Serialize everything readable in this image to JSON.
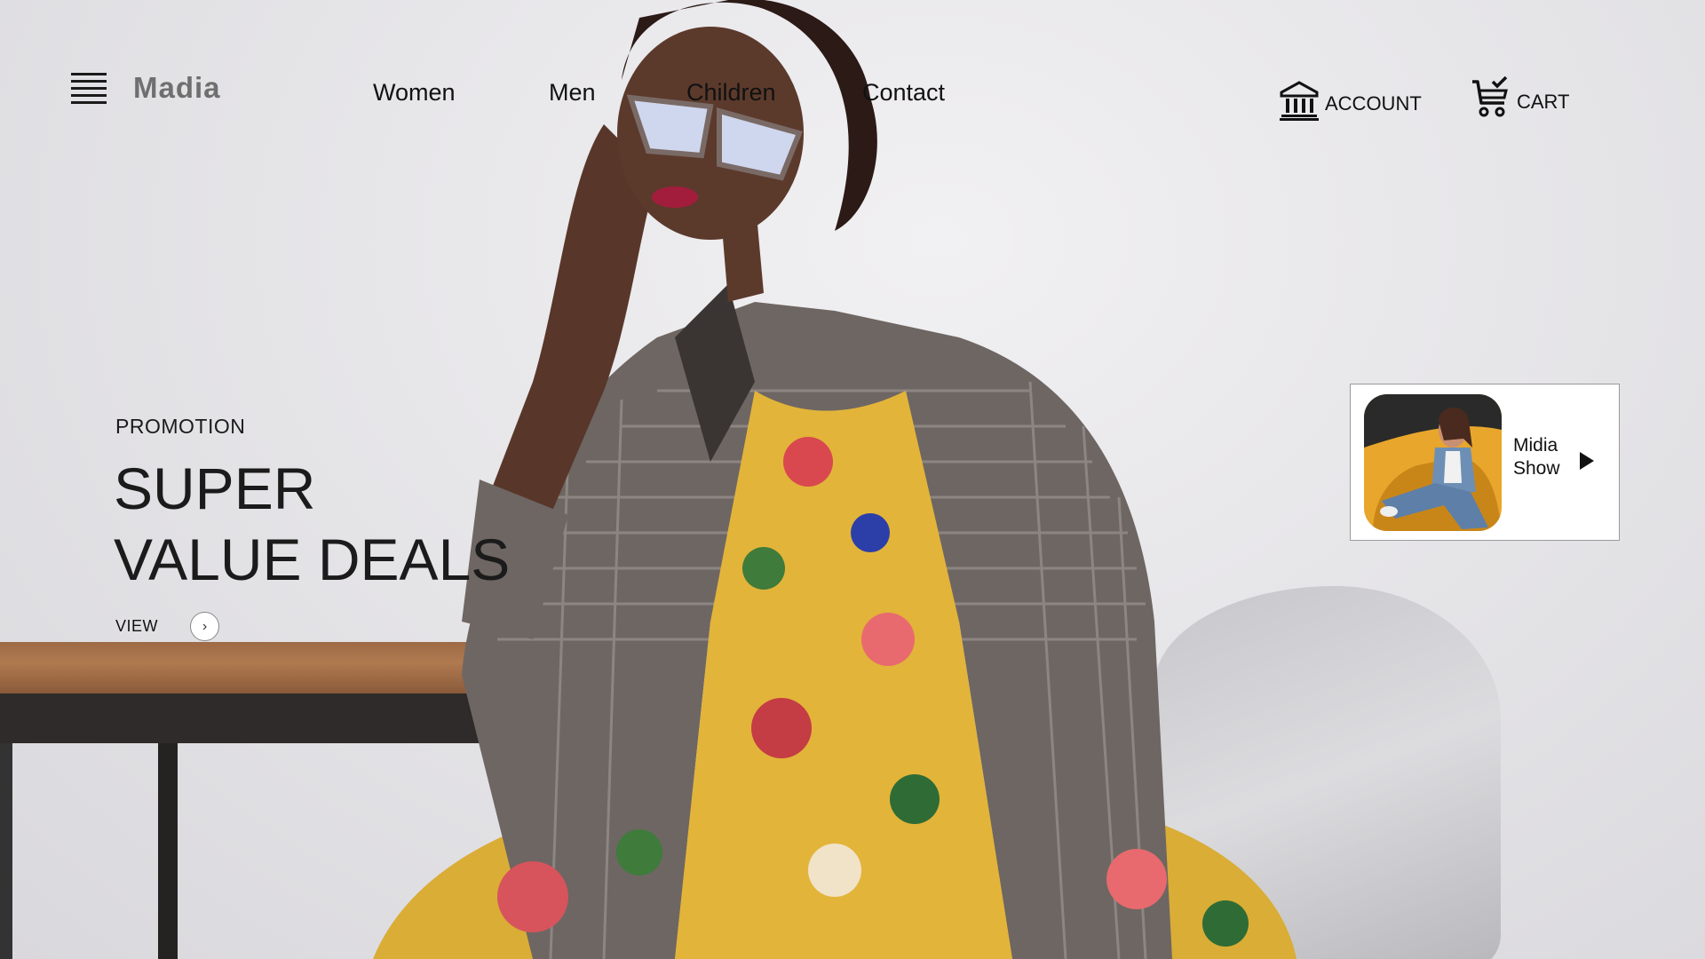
{
  "header": {
    "brand": "Madia",
    "menu_icon": "hamburger-menu-icon",
    "nav": [
      {
        "label": "Women"
      },
      {
        "label": "Men"
      },
      {
        "label": "Children"
      },
      {
        "label": "Contact"
      }
    ],
    "account": {
      "label": "ACCOUNT",
      "icon": "bank-icon"
    },
    "cart": {
      "label": "CART",
      "icon": "cart-check-icon"
    }
  },
  "hero": {
    "kicker": "PROMOTION",
    "title_line1": "SUPER",
    "title_line2": "VALUE DEALS",
    "view_label": "VIEW",
    "view_icon": "chevron-right-icon"
  },
  "media_card": {
    "line1": "Midia",
    "line2": "Show",
    "icon": "play-icon"
  },
  "colors": {
    "text": "#111111",
    "brand": "#6f6f6f",
    "wall": "#e4e3e6",
    "dress": "#e2b43a"
  }
}
